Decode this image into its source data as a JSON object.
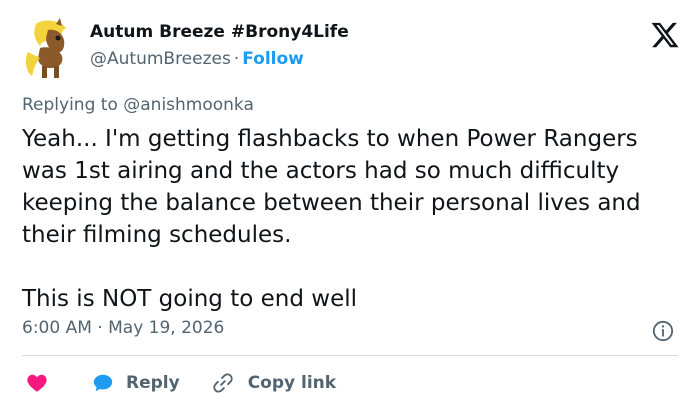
{
  "author": {
    "display_name": "Autum Breeze #Brony4Life",
    "handle": "@AutumBreezes",
    "separator": "·",
    "follow_label": "Follow",
    "avatar_icon": "pony-avatar"
  },
  "brand_icon": "x-logo-icon",
  "reply_context": {
    "prefix": "Replying to",
    "mention": "@anishmoonka"
  },
  "tweet": {
    "text": "Yeah... I'm getting flashbacks to when Power Rangers was 1st airing and the actors had so much difficulty keeping the balance between their personal lives and their filming schedules.\n\nThis is NOT going to end well"
  },
  "meta": {
    "time": "6:00 AM",
    "separator": "·",
    "date": "May 19, 2026"
  },
  "actions": {
    "like_icon": "heart-icon",
    "reply_label": "Reply",
    "copy_link_label": "Copy link"
  },
  "colors": {
    "accent": "#1d9bf0",
    "like": "#f91880",
    "muted": "#536471",
    "text": "#0f1419",
    "divider": "#cfd9de"
  }
}
